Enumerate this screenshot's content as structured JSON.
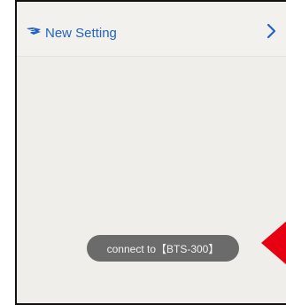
{
  "header": {
    "title": "New Setting",
    "logo_icon": "brand-wing-icon",
    "next_icon": "chevron-right-icon"
  },
  "toast": {
    "message": "connect to【BTS-300】"
  },
  "annotation": {
    "icon": "red-pointer-arrow-icon"
  },
  "colors": {
    "title_blue": "#2663bf",
    "background": "#efeeeb",
    "toast_bg": "#6b6b6b",
    "arrow_red": "#e60012"
  }
}
